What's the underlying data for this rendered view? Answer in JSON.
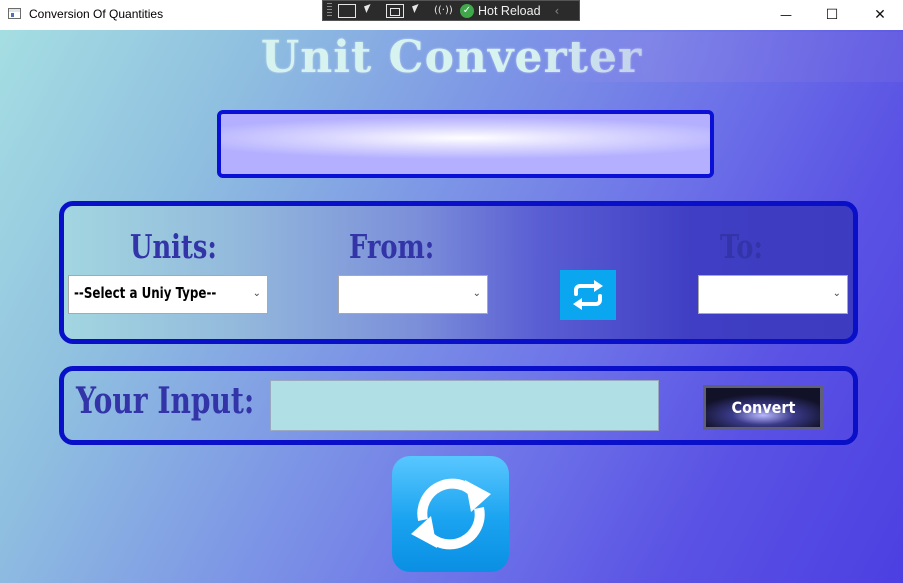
{
  "window": {
    "title": "Conversion Of Quantities",
    "controls": {
      "minimize": "—",
      "maximize": "☐",
      "close": "✕"
    }
  },
  "debug_toolbar": {
    "hot_reload_label": "Hot Reload"
  },
  "app": {
    "title": "Unit Converter",
    "result_text": "",
    "units_label": "Units:",
    "from_label": "From:",
    "to_label": "To:",
    "unit_type_select": {
      "value": "--Select a Uniy Type--"
    },
    "from_select": {
      "value": ""
    },
    "to_select": {
      "value": ""
    },
    "input_label": "Your Input:",
    "input_value": "",
    "convert_label": "Convert"
  },
  "icons": {
    "swap": "swap-arrows-icon",
    "refresh": "refresh-icon",
    "dropdown": "chevron-down-icon"
  },
  "colors": {
    "panel_border": "#0a10c8",
    "label_text": "#3234a8",
    "swap_button": "#0aa6ef",
    "input_field": "#b0dfe6"
  }
}
